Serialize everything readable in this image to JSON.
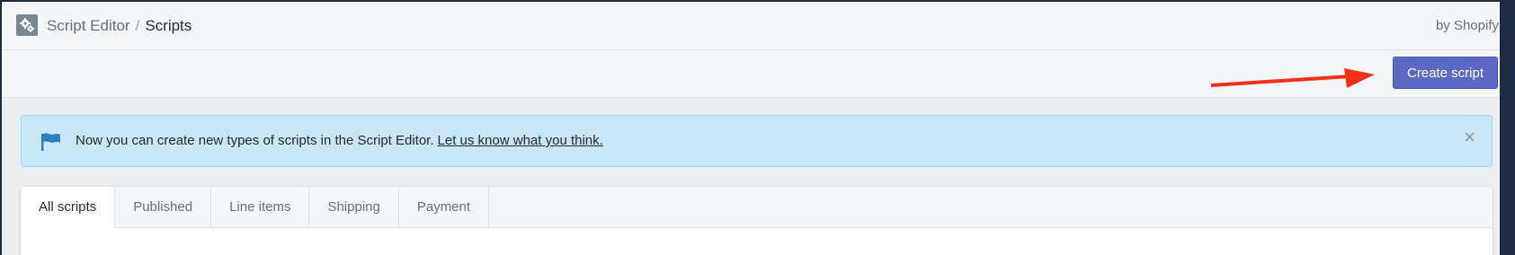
{
  "topbar": {
    "app_name": "Script Editor",
    "separator": "/",
    "page_name": "Scripts",
    "vendor": "by Shopify",
    "icon": "gears-icon"
  },
  "actions": {
    "create_label": "Create script",
    "accent_color": "#5c6ac4"
  },
  "annotation": {
    "arrow_color": "#f2311a"
  },
  "banner": {
    "message": "Now you can create new types of scripts in the Script Editor.",
    "link_text": "Let us know what you think.",
    "close_glyph": "×",
    "icon": "flag-icon",
    "background": "#c9e6f6"
  },
  "tabs": [
    {
      "label": "All scripts",
      "active": true
    },
    {
      "label": "Published",
      "active": false
    },
    {
      "label": "Line items",
      "active": false
    },
    {
      "label": "Shipping",
      "active": false
    },
    {
      "label": "Payment",
      "active": false
    }
  ]
}
